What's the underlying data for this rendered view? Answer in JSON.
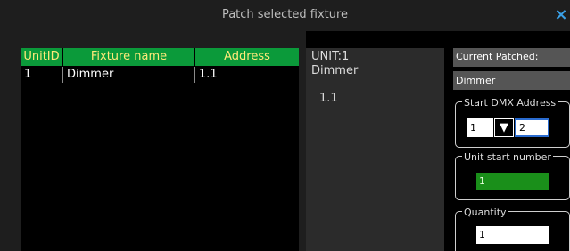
{
  "dialog": {
    "title": "Patch selected fixture",
    "close_glyph": "×"
  },
  "table": {
    "headers": {
      "unit_id": "UnitID",
      "fixture_name": "Fixture name",
      "address": "Address"
    },
    "rows": [
      {
        "unit_id": "1",
        "fixture_name": "Dimmer",
        "address": "1.1"
      }
    ]
  },
  "details": {
    "unit": "UNIT:1",
    "fixture_type": "Dimmer",
    "address": "1.1"
  },
  "patch": {
    "current_patched_label": "Current Patched:",
    "current_patched_value": "Dimmer",
    "start_dmx_label": "Start DMX Address",
    "start_dmx_value": "1",
    "dropdown_glyph": "▼",
    "start_dmx_end_value": "2",
    "unit_start_label": "Unit start number",
    "unit_start_value": "1",
    "quantity_label": "Quantity",
    "quantity_value": "1"
  },
  "colors": {
    "header_bg": "#0b9a3a",
    "header_text": "#ffe97a",
    "accent": "#3aa0e6",
    "field_green": "#1a8f1a"
  }
}
